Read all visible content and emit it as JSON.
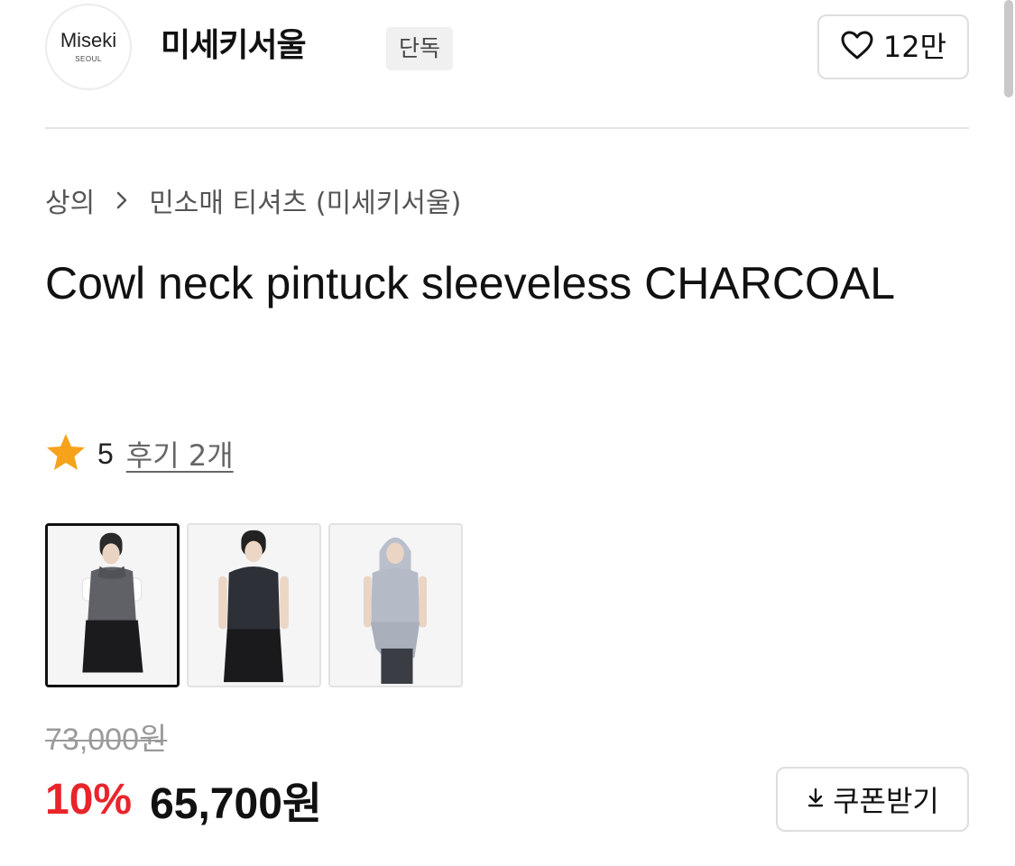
{
  "store": {
    "logo_text": "Miseki",
    "logo_subtext": "SEOUL",
    "name": "미세키서울",
    "badge": "단독",
    "like_count": "12만"
  },
  "breadcrumb": {
    "category": "상의",
    "subcategory": "민소매 티셔츠 (미세키서울)"
  },
  "product": {
    "title": "Cowl neck pintuck sleeveless CHARCOAL",
    "rating": "5",
    "review_link": "후기 2개",
    "thumbnail_count": 3,
    "selected_thumbnail": 1
  },
  "price": {
    "original": "73,000원",
    "discount_rate": "10%",
    "sale": "65,700원"
  },
  "coupon": {
    "label": "쿠폰받기"
  },
  "colors": {
    "discount": "#e8252b",
    "star": "#f7a21b",
    "text": "#111111"
  }
}
